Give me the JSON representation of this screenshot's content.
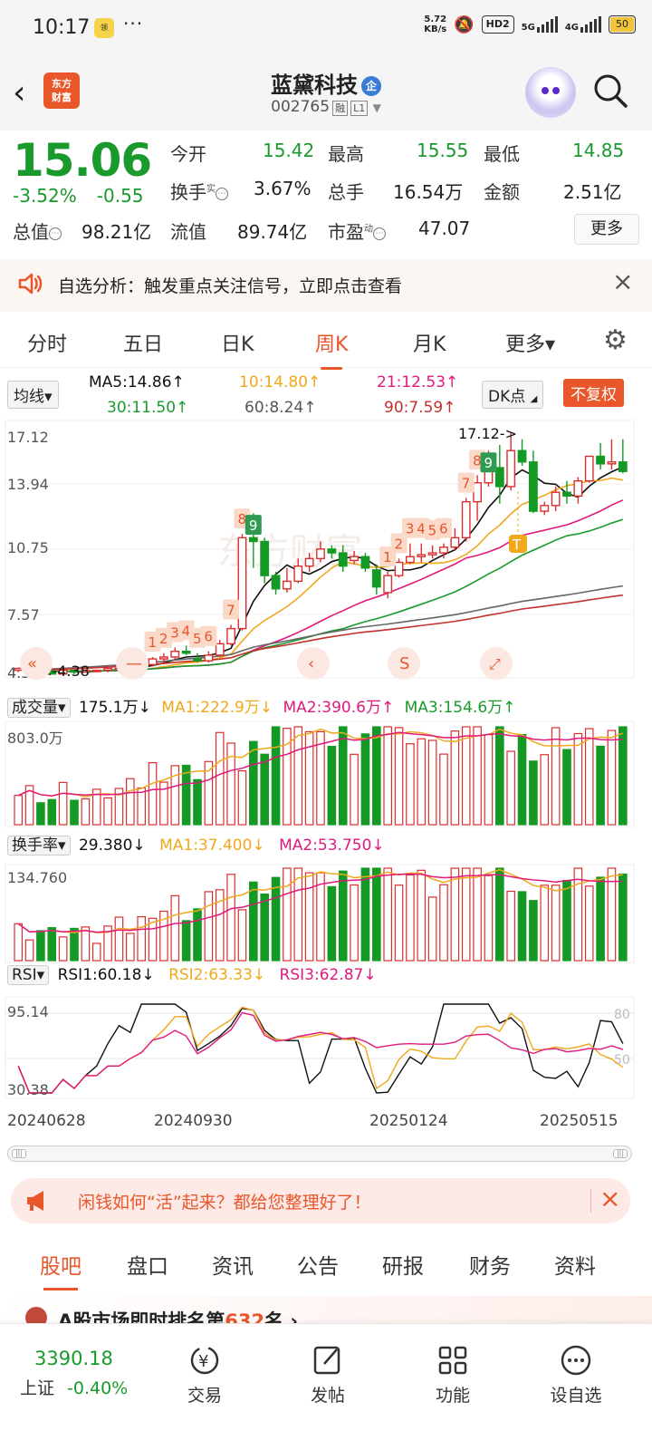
{
  "status": {
    "time": "10:17",
    "dots": "···",
    "speed_top": "5.72",
    "speed_bottom": "KB/s",
    "hd": "HD2",
    "net1": "5G",
    "net2": "4G",
    "battery": "50"
  },
  "header": {
    "logo_line1": "东方",
    "logo_line2": "财富",
    "title": "蓝黛科技",
    "title_badge": "企",
    "code": "002765",
    "tag1": "融",
    "tag2": "L1"
  },
  "quote": {
    "price": "15.06",
    "change_pct": "-3.52%",
    "change": "-0.55",
    "items": [
      {
        "label": "今开",
        "value": "15.42"
      },
      {
        "label": "最高",
        "value": "15.55"
      },
      {
        "label": "最低",
        "value": "14.85"
      },
      {
        "label": "换手",
        "sup": "实",
        "value": "3.67%"
      },
      {
        "label": "总手",
        "value": "16.54万"
      },
      {
        "label": "金额",
        "value": "2.51亿"
      },
      {
        "label": "总值",
        "value": "98.21亿"
      },
      {
        "label": "流值",
        "value": "89.74亿"
      },
      {
        "label": "市盈",
        "sup": "动",
        "value": "47.07"
      }
    ],
    "more_label": "更多"
  },
  "alert": {
    "text": "自选分析：触发重点关注信号，立即点击查看"
  },
  "tabs": [
    "分时",
    "五日",
    "日K",
    "周K",
    "月K",
    "更多▾"
  ],
  "ma_row": {
    "selector": "均线▾",
    "ma5": "MA5:14.86↑",
    "ma10": "10:14.80↑",
    "ma21": "21:12.53↑",
    "ma30": "30:11.50↑",
    "ma60": "60:8.24↑",
    "ma90": "90:7.59↑",
    "dk": "DK点",
    "fq": "不复权"
  },
  "colors": {
    "up": "#d9302f",
    "down": "#149a24",
    "ma5": "#111111",
    "ma10": "#f0a81c",
    "ma21": "#e0197d",
    "ma30": "#1a9a2c",
    "ma60": "#666666",
    "ma90": "#c4302b",
    "accent": "#e8562a"
  },
  "chart_data": [
    {
      "type": "candlestick",
      "title": "周K",
      "y_ticks": [
        "17.12",
        "13.94",
        "10.75",
        "7.57",
        "4.39"
      ],
      "ylim": [
        4.39,
        17.12
      ],
      "annotations": [
        "17.12->",
        "<-4.38"
      ],
      "td_labels": [
        "1",
        "2",
        "3",
        "4",
        "5",
        "6",
        "7",
        "8",
        "9",
        "1",
        "2",
        "3",
        "4",
        "5",
        "6",
        "7",
        "8",
        "9"
      ],
      "signal_label": "T",
      "x_labels": [
        "20240628",
        "20240930",
        "20250124",
        "20250515"
      ],
      "candles": [
        [
          4.6,
          4.7,
          4.5,
          4.7
        ],
        [
          4.6,
          4.7,
          4.5,
          4.6
        ],
        [
          4.6,
          4.6,
          4.4,
          4.5
        ],
        [
          4.5,
          4.5,
          4.38,
          4.4
        ],
        [
          4.4,
          4.6,
          4.4,
          4.6
        ],
        [
          4.6,
          4.6,
          4.4,
          4.5
        ],
        [
          4.5,
          4.6,
          4.5,
          4.6
        ],
        [
          4.6,
          4.6,
          4.5,
          4.6
        ],
        [
          4.6,
          4.7,
          4.5,
          4.7
        ],
        [
          4.7,
          4.8,
          4.6,
          4.7
        ],
        [
          4.7,
          4.9,
          4.7,
          4.8
        ],
        [
          4.8,
          5.0,
          4.7,
          4.9
        ],
        [
          4.9,
          5.3,
          4.8,
          5.2
        ],
        [
          5.2,
          5.5,
          5.0,
          5.3
        ],
        [
          5.3,
          5.8,
          5.2,
          5.6
        ],
        [
          5.6,
          5.9,
          5.4,
          5.5
        ],
        [
          5.2,
          5.5,
          5.0,
          5.1
        ],
        [
          5.1,
          5.6,
          5.0,
          5.4
        ],
        [
          5.4,
          6.2,
          5.3,
          6.0
        ],
        [
          6.0,
          7.0,
          5.9,
          6.8
        ],
        [
          6.8,
          11.8,
          6.7,
          11.6
        ],
        [
          11.6,
          12.9,
          10.0,
          11.4
        ],
        [
          11.4,
          11.6,
          9.2,
          9.6
        ],
        [
          9.6,
          9.8,
          8.6,
          8.9
        ],
        [
          8.9,
          10.0,
          8.7,
          9.3
        ],
        [
          9.3,
          10.5,
          9.2,
          10.1
        ],
        [
          10.1,
          10.8,
          9.8,
          10.5
        ],
        [
          10.5,
          11.4,
          10.3,
          11.0
        ],
        [
          11.0,
          11.2,
          10.5,
          10.8
        ],
        [
          10.8,
          11.2,
          9.8,
          10.1
        ],
        [
          10.4,
          10.9,
          10.2,
          10.6
        ],
        [
          10.6,
          10.8,
          9.8,
          10.0
        ],
        [
          9.9,
          10.2,
          8.6,
          9.0
        ],
        [
          8.7,
          9.8,
          8.4,
          9.6
        ],
        [
          9.6,
          10.5,
          9.5,
          10.3
        ],
        [
          10.3,
          11.3,
          10.2,
          10.6
        ],
        [
          10.6,
          11.3,
          10.3,
          10.7
        ],
        [
          10.7,
          11.2,
          10.5,
          10.8
        ],
        [
          10.8,
          11.3,
          10.5,
          11.1
        ],
        [
          11.1,
          12.1,
          10.9,
          11.6
        ],
        [
          11.6,
          13.7,
          11.4,
          13.5
        ],
        [
          13.5,
          14.9,
          12.5,
          14.5
        ],
        [
          14.5,
          16.2,
          14.3,
          15.3
        ],
        [
          15.3,
          16.5,
          13.4,
          14.3
        ],
        [
          14.3,
          17.12,
          14.1,
          16.2
        ],
        [
          16.2,
          16.8,
          15.4,
          15.6
        ],
        [
          15.6,
          16.2,
          12.9,
          13.0
        ],
        [
          13.0,
          13.5,
          12.8,
          13.3
        ],
        [
          13.3,
          14.3,
          13.0,
          14.0
        ],
        [
          14.0,
          14.6,
          13.4,
          13.8
        ],
        [
          13.8,
          14.8,
          13.4,
          14.6
        ],
        [
          14.6,
          15.8,
          14.5,
          15.9
        ],
        [
          15.9,
          16.6,
          15.2,
          15.5
        ],
        [
          15.5,
          16.8,
          15.2,
          15.6
        ],
        [
          15.6,
          16.8,
          15.0,
          15.1
        ]
      ]
    },
    {
      "type": "bar",
      "title": "成交量",
      "y_tick": "803.0万",
      "series_labels": [
        "175.1万↓",
        "MA1:222.9万↓",
        "MA2:390.6万↑",
        "MA3:154.6万↑"
      ]
    },
    {
      "type": "bar",
      "title": "换手率",
      "y_tick": "134.760",
      "series_labels": [
        "29.380↓",
        "MA1:37.400↓",
        "MA2:53.750↓"
      ]
    },
    {
      "type": "line",
      "title": "RSI",
      "y_ticks": [
        "95.14",
        "30.38"
      ],
      "ref_lines": [
        "80",
        "50"
      ],
      "series_labels": [
        "RSI1:60.18↓",
        "RSI2:63.33↓",
        "RSI3:62.87↓"
      ]
    }
  ],
  "promo": {
    "text": "闲钱如何“活”起来？都给您整理好了！"
  },
  "bottom_tabs": [
    "股吧",
    "盘口",
    "资讯",
    "公告",
    "研报",
    "财务",
    "资料"
  ],
  "news": {
    "text_prefix": "A股市场即时排名第",
    "rank": "632",
    "text_suffix": "名 ›"
  },
  "bottom_bar": {
    "index_value": "3390.18",
    "index_name": "上证",
    "index_change": "-0.40%",
    "items": [
      {
        "icon": "¥",
        "label": "交易"
      },
      {
        "icon": "✎",
        "label": "发帖"
      },
      {
        "icon": "▦",
        "label": "功能"
      },
      {
        "icon": "⋯",
        "label": "设自选"
      }
    ]
  }
}
